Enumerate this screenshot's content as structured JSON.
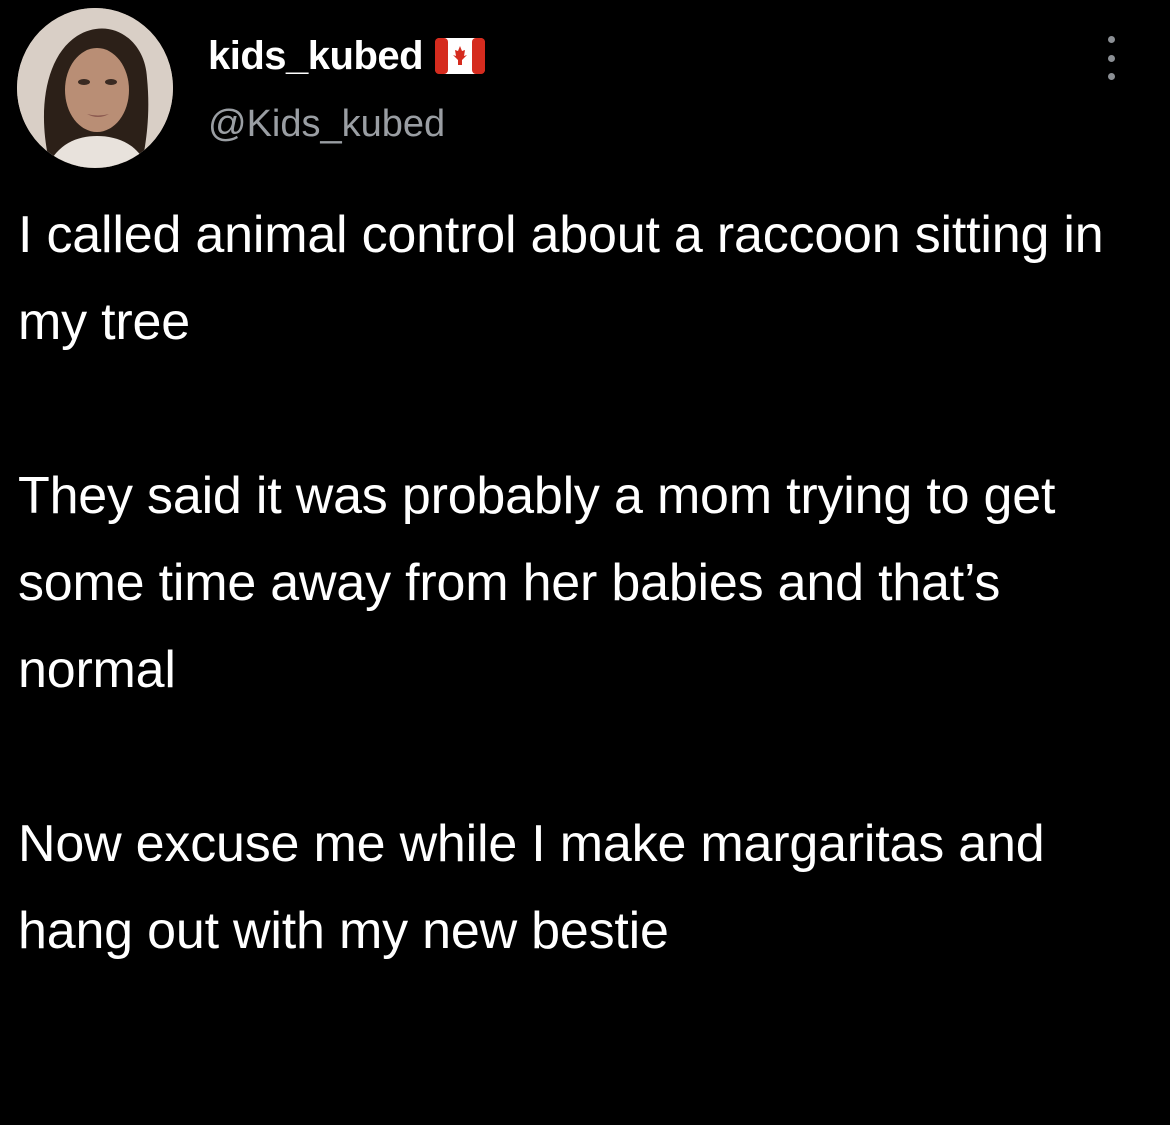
{
  "tweet": {
    "author": {
      "display_name": "kids_kubed",
      "handle": "@Kids_kubed",
      "avatar_icon": "avatar-photo",
      "badge_icon": "canada-flag-icon"
    },
    "more_icon": "more-vertical-icon",
    "paragraphs": [
      "I called animal control about a raccoon sitting in my tree",
      "They said it was probably a mom trying to get some time away from her babies and that’s normal",
      "Now excuse me while I make margaritas and hang out with my new bestie"
    ]
  },
  "colors": {
    "background": "#000000",
    "text": "#ffffff",
    "handle": "#9a9ea3",
    "flag_red": "#d52b1e"
  }
}
